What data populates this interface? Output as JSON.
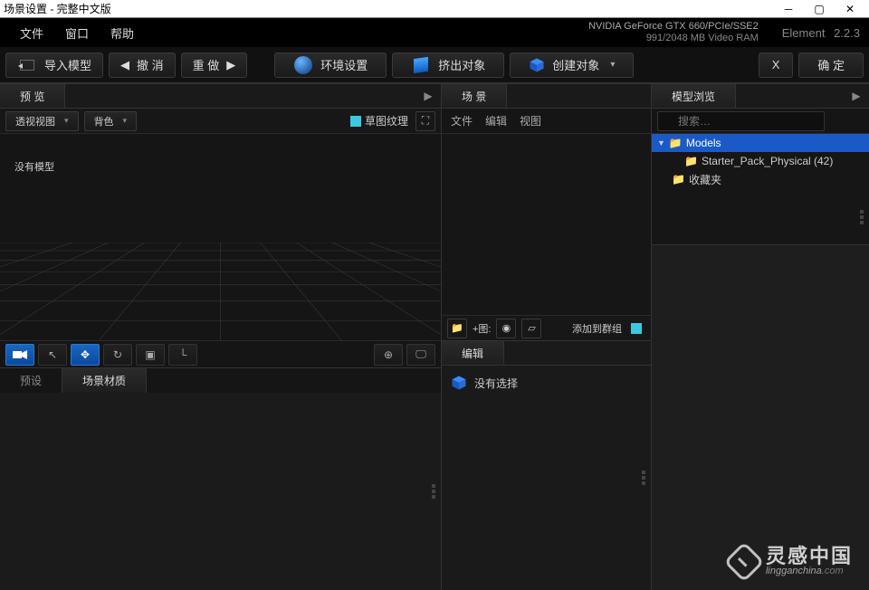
{
  "titlebar": {
    "title": "场景设置 - 完整中文版"
  },
  "menubar": {
    "items": [
      "文件",
      "窗口",
      "帮助"
    ],
    "gpu_line1": "NVIDIA GeForce GTX 660/PCIe/SSE2",
    "gpu_line2": "991/2048 MB Video RAM",
    "app_name": "Element",
    "app_version": "2.2.3"
  },
  "toolbar": {
    "import": "导入模型",
    "undo": "撤 消",
    "redo": "重 做",
    "env": "环境设置",
    "extrude": "挤出对象",
    "create": "创建对象",
    "x": "X",
    "ok": "确 定"
  },
  "preview": {
    "tab": "预 览",
    "view_select": "透视视图",
    "bgcolor_select": "背色",
    "draft_label": "草图纹理",
    "empty_msg": "没有模型"
  },
  "presets": {
    "tab_presets": "预设",
    "tab_materials": "场景材质"
  },
  "scene": {
    "tab": "场 景",
    "menus": [
      "文件",
      "编辑",
      "视图"
    ],
    "add_img_label": "+图:",
    "add_group": "添加到群组"
  },
  "edit": {
    "tab": "编辑",
    "empty": "没有选择"
  },
  "models": {
    "tab": "模型浏览",
    "search_placeholder": "搜索…",
    "tree": {
      "root": "Models",
      "child": "Starter_Pack_Physical (42)",
      "fav": "收藏夹"
    }
  },
  "watermark": {
    "cn": "灵感中国",
    "en_main": "lingganchina",
    "en_suffix": ".com"
  }
}
